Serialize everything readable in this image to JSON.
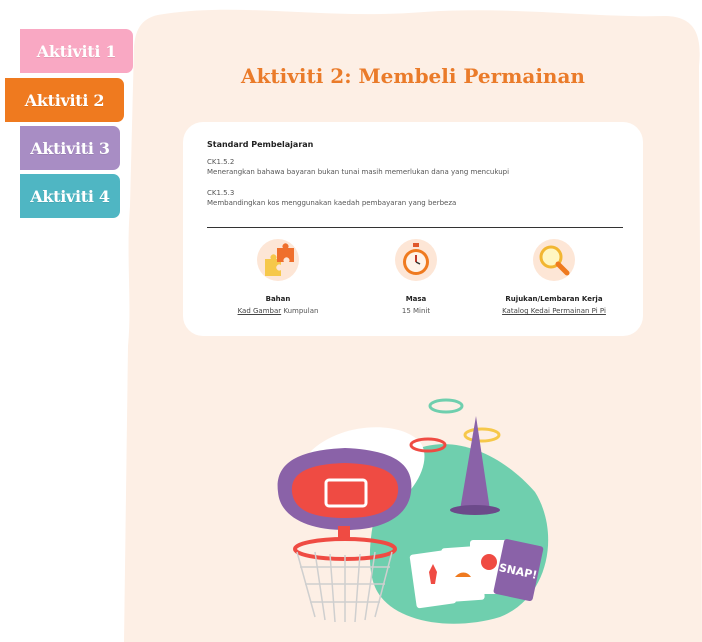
{
  "tabs": [
    {
      "label": "Aktiviti 1"
    },
    {
      "label": "Aktiviti 2"
    },
    {
      "label": "Aktiviti 3"
    },
    {
      "label": "Aktiviti 4"
    }
  ],
  "page": {
    "title": "Aktiviti 2: Membeli Permainan"
  },
  "standards": {
    "heading": "Standard Pembelajaran",
    "items": [
      {
        "code": "CK1.5.2",
        "text": "Menerangkan bahawa bayaran bukan tunai masih memerlukan dana yang mencukupi"
      },
      {
        "code": "CK1.5.3",
        "text": "Membandingkan kos menggunakan kaedah pembayaran yang berbeza"
      }
    ]
  },
  "info": {
    "bahan": {
      "label": "Bahan",
      "link": "Kad Gambar",
      "suffix": " Kumpulan",
      "icon": "puzzle-icon"
    },
    "masa": {
      "label": "Masa",
      "value": "15 Minit",
      "icon": "stopwatch-icon"
    },
    "rujukan": {
      "label": "Rujukan/Lembaran Kerja",
      "link": "Katalog Kedai Permainan Pi Pi",
      "icon": "magnifier-icon"
    }
  },
  "illustration": {
    "card_text": "SNAP!"
  },
  "colors": {
    "accent": "#ea7b2a",
    "panel": "#fdefe5",
    "pink": "#f9a8c3",
    "orange": "#ef7a1f",
    "purple": "#a88dc4",
    "teal": "#4fb6c3"
  }
}
